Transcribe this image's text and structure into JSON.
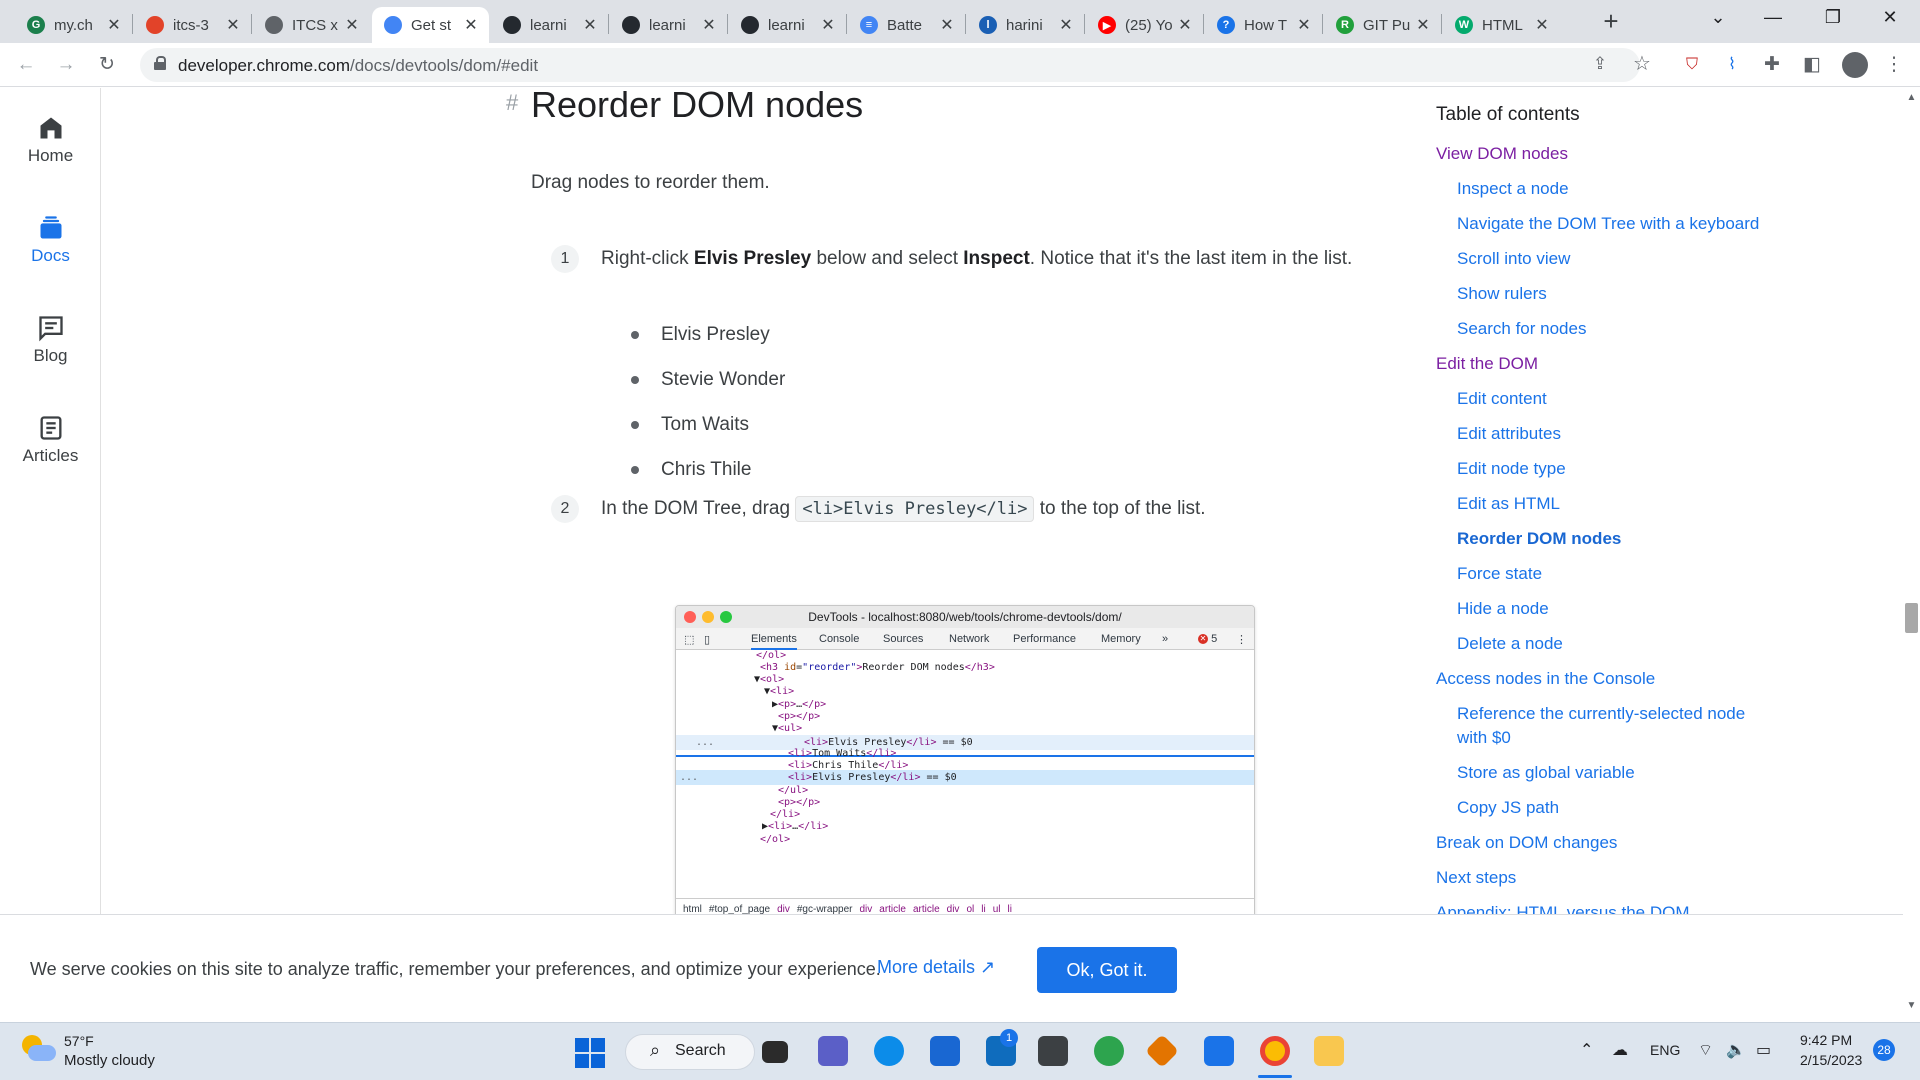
{
  "browser": {
    "tabs": [
      {
        "title": "my.ch",
        "icon": "g-icon",
        "color": "#1b7f4c",
        "glyph": "G"
      },
      {
        "title": "itcs-3",
        "icon": "gitlab-icon",
        "color": "#e24329",
        "glyph": ""
      },
      {
        "title": "ITCS x",
        "icon": "globe-icon",
        "color": "#5f6368",
        "glyph": ""
      },
      {
        "title": "Get st",
        "icon": "chrome-icon",
        "color": "#4285f4",
        "glyph": ""
      },
      {
        "title": "learni",
        "icon": "github-icon",
        "color": "#24292f",
        "glyph": ""
      },
      {
        "title": "learni",
        "icon": "github-icon",
        "color": "#24292f",
        "glyph": ""
      },
      {
        "title": "learni",
        "icon": "github-icon",
        "color": "#24292f",
        "glyph": ""
      },
      {
        "title": "Batte",
        "icon": "docs-icon",
        "color": "#4285f4",
        "glyph": "≡"
      },
      {
        "title": "harini",
        "icon": "analytics-icon",
        "color": "#1a5fb4",
        "glyph": "l"
      },
      {
        "title": "(25) Yo",
        "icon": "youtube-icon",
        "color": "#ff0000",
        "glyph": "▶"
      },
      {
        "title": "How T",
        "icon": "help-icon",
        "color": "#1a73e8",
        "glyph": "?"
      },
      {
        "title": "GIT Pu",
        "icon": "git-icon",
        "color": "#21a03c",
        "glyph": "R"
      },
      {
        "title": "HTML",
        "icon": "w3-icon",
        "color": "#04aa6d",
        "glyph": "W"
      }
    ],
    "active_tab": 3,
    "url_host": "developer.chrome.com",
    "url_path": "/docs/devtools/dom/#edit"
  },
  "rail": [
    {
      "label": "Home",
      "icon": "home-icon"
    },
    {
      "label": "Docs",
      "icon": "docs-stack-icon"
    },
    {
      "label": "Blog",
      "icon": "blog-icon"
    },
    {
      "label": "Articles",
      "icon": "articles-icon"
    }
  ],
  "article": {
    "heading": "Reorder DOM nodes",
    "hash": "#",
    "intro": "Drag nodes to reorder them.",
    "step1": {
      "num": "1",
      "pre": "Right-click ",
      "b1": "Elvis Presley",
      "mid": " below and select ",
      "b2": "Inspect",
      "post": ". Notice that it's the last item in the list."
    },
    "bullets": [
      "Elvis Presley",
      "Stevie Wonder",
      "Tom Waits",
      "Chris Thile"
    ],
    "step2": {
      "num": "2",
      "pre": "In the DOM Tree, drag ",
      "code": "<li>Elvis Presley</li>",
      "post": " to the top of the list."
    }
  },
  "devtools": {
    "title": "DevTools - localhost:8080/web/tools/chrome-devtools/dom/",
    "tabs": [
      "Elements",
      "Console",
      "Sources",
      "Network",
      "Performance",
      "Memory",
      "»"
    ],
    "error_count": "5",
    "lines": [
      "</ol>",
      "<h3 id=\"reorder\">Reorder DOM nodes</h3>",
      "▼<ol>",
      "▼<li>",
      "▶<p>…</p>",
      "<p></p>",
      "▼<ul>",
      "<li>Elvis Presley</li> == $0",
      "<li>Tom Waits</li>",
      "<li>Chris Thile</li>",
      "<li>Elvis Presley</li> == $0",
      "</ul>",
      "<p></p>",
      "</li>",
      "▶<li>…</li>",
      "</ol>"
    ],
    "ellipsis": "...",
    "breadcrumbs": [
      "html",
      "#top_of_page",
      "div",
      "#gc-wrapper",
      "div",
      "article",
      "article",
      "div",
      "ol",
      "li",
      "ul",
      "li"
    ]
  },
  "toc": {
    "title": "Table of contents",
    "items": [
      {
        "label": "View DOM nodes",
        "level": 1,
        "visited": true
      },
      {
        "label": "Inspect a node",
        "level": 2
      },
      {
        "label": "Navigate the DOM Tree with a keyboard",
        "level": 2
      },
      {
        "label": "Scroll into view",
        "level": 2
      },
      {
        "label": "Show rulers",
        "level": 2
      },
      {
        "label": "Search for nodes",
        "level": 2
      },
      {
        "label": "Edit the DOM",
        "level": 1,
        "visited": true
      },
      {
        "label": "Edit content",
        "level": 2
      },
      {
        "label": "Edit attributes",
        "level": 2
      },
      {
        "label": "Edit node type",
        "level": 2
      },
      {
        "label": "Edit as HTML",
        "level": 2
      },
      {
        "label": "Reorder DOM nodes",
        "level": 2,
        "current": true
      },
      {
        "label": "Force state",
        "level": 2
      },
      {
        "label": "Hide a node",
        "level": 2
      },
      {
        "label": "Delete a node",
        "level": 2
      },
      {
        "label": "Access nodes in the Console",
        "level": 1
      },
      {
        "label": "Reference the currently-selected node",
        "level": 2
      },
      {
        "label": "with $0",
        "level": 2
      },
      {
        "label": "Store as global variable",
        "level": 2
      },
      {
        "label": "Copy JS path",
        "level": 2
      },
      {
        "label": "Break on DOM changes",
        "level": 1
      },
      {
        "label": "Next steps",
        "level": 1
      },
      {
        "label": "Appendix: HTML versus the DOM",
        "level": 1
      }
    ]
  },
  "cookie": {
    "text": "We serve cookies on this site to analyze traffic, remember your preferences, and optimize your experience.",
    "more": "More details",
    "ok": "Ok, Got it."
  },
  "taskbar": {
    "temp": "57°F",
    "weather": "Mostly cloudy",
    "search": "Search",
    "lang": "ENG",
    "time": "9:42 PM",
    "date": "2/15/2023",
    "notifications": "28",
    "mail_badge": "1"
  }
}
